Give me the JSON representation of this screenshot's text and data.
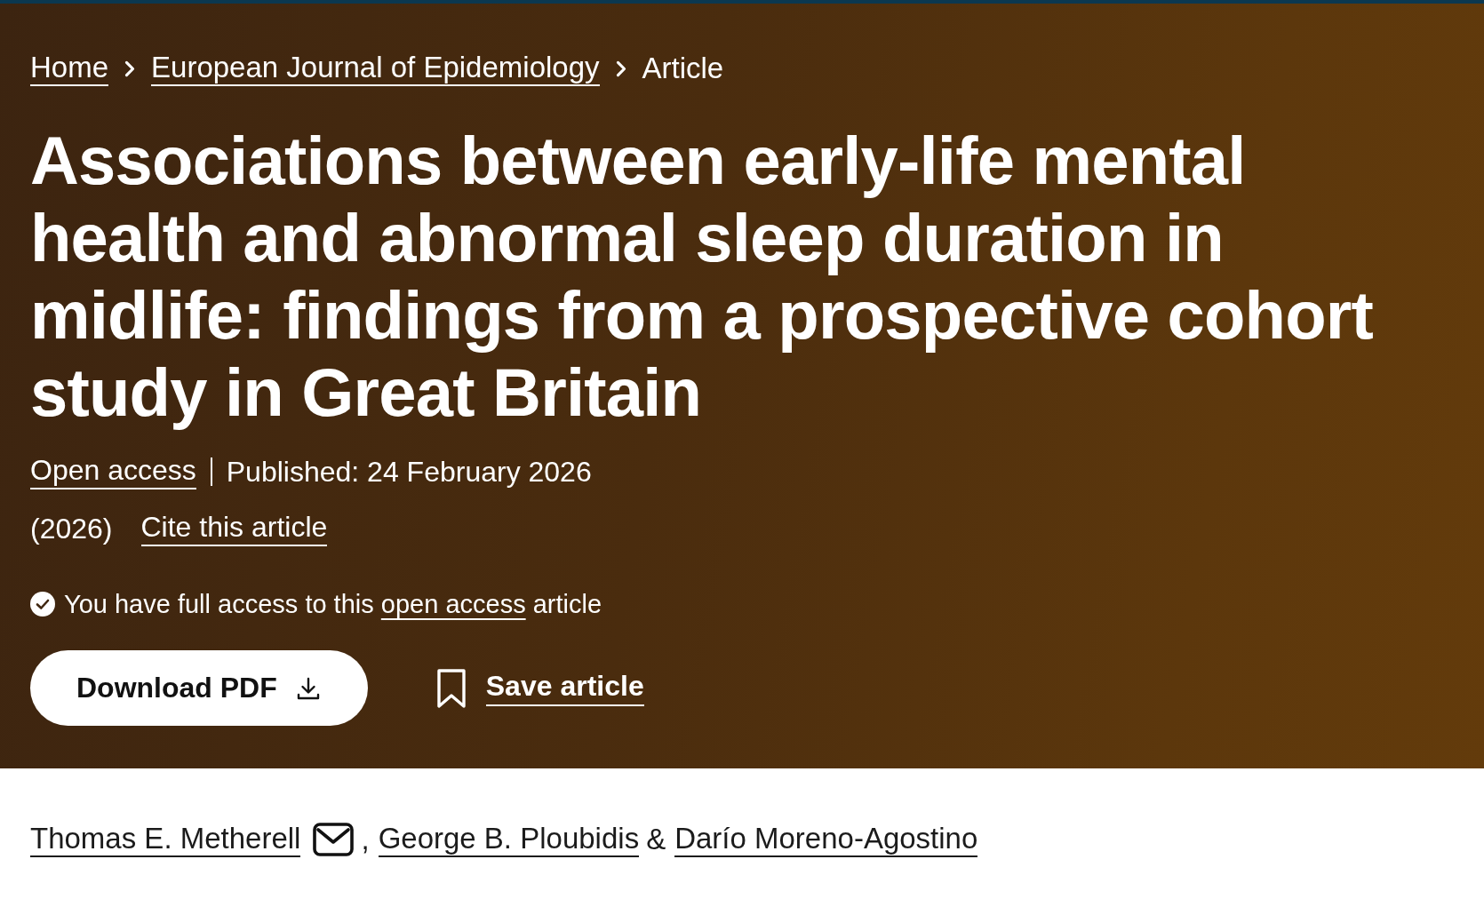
{
  "breadcrumbs": [
    {
      "label": "Home",
      "kind": "link"
    },
    {
      "label": "European Journal of Epidemiology",
      "kind": "link"
    },
    {
      "label": "Article",
      "kind": "current"
    }
  ],
  "article": {
    "title": "Associations between early-life mental health and abnormal sleep duration in midlife: findings from a prospective cohort study in Great Britain",
    "access_type": "Open access",
    "published": "Published: 24 February 2026",
    "year": "(2026)",
    "cite_link": "Cite this article",
    "access_notice": {
      "text_before": "You have full access to this",
      "link": "open access",
      "text_after": "article"
    },
    "download_button": "Download PDF",
    "save_button": "Save article"
  },
  "authors": [
    {
      "name": "Thomas E. Metherell",
      "corresponding": true,
      "separator": ","
    },
    {
      "name": "George B. Ploubidis",
      "corresponding": false,
      "separator": "&"
    },
    {
      "name": "Darío Moreno-Agostino",
      "corresponding": false
    }
  ]
}
